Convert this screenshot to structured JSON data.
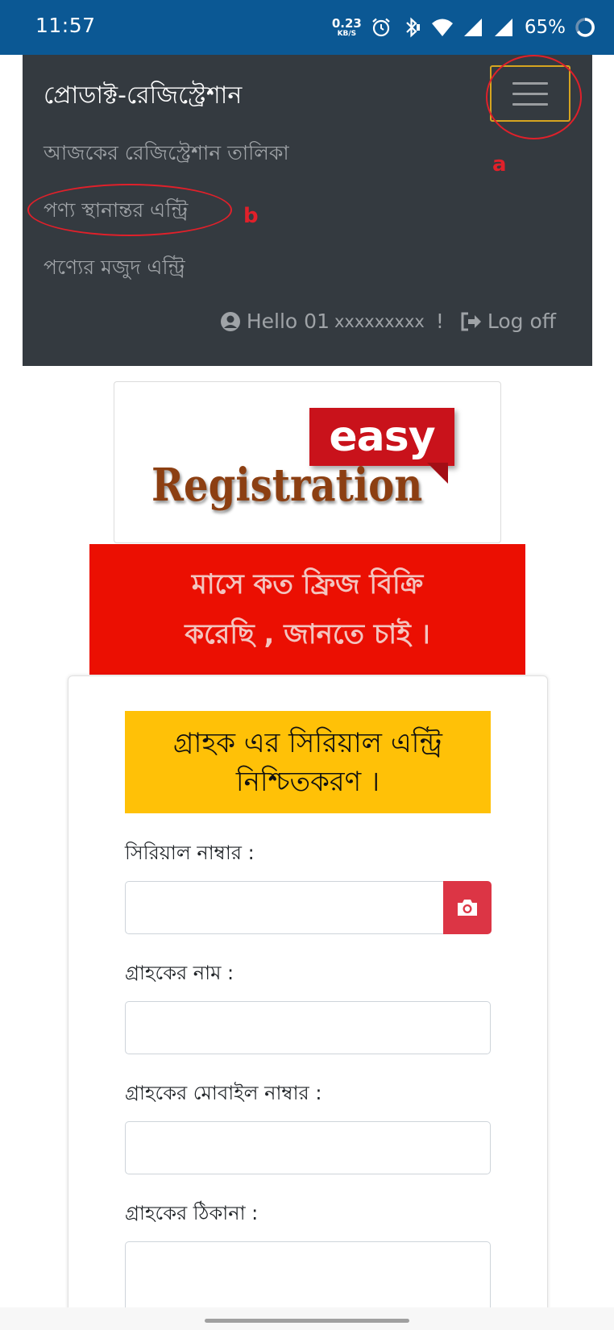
{
  "status_bar": {
    "time": "11:57",
    "net_speed_value": "0.23",
    "net_speed_unit": "KB/S",
    "battery": "65%",
    "icons": [
      "alarm-icon",
      "bluetooth-icon",
      "wifi-icon",
      "signal-icon",
      "signal-icon",
      "battery-icon"
    ]
  },
  "navbar": {
    "brand": "প্রোডাক্ট-রেজিস্ট্রেশান",
    "links": [
      {
        "label": "আজকের রেজিস্ট্রেশান তালিকা"
      },
      {
        "label": "পণ্য স্থানান্তর এন্ট্রি"
      },
      {
        "label": "পণ্যের মজুদ এন্ট্রি"
      }
    ],
    "hello_text": "Hello 01",
    "hello_masked": "xxxxxxxxx",
    "hello_suffix": "!",
    "logoff": "Log off",
    "toggler_icon": "hamburger-menu-icon"
  },
  "annotations": {
    "a": "a",
    "b": "b",
    "color": "#e0202a"
  },
  "logo": {
    "word1": "easy",
    "word2": "Registration"
  },
  "banner": {
    "line1": "মাসে কত ফ্রিজ বিক্রি",
    "line2": "করেছি , জানতে চাই ।",
    "color": "#eb0f02"
  },
  "form": {
    "heading_line1": "গ্রাহক এর সিরিয়াল এন্ট্রি",
    "heading_line2": "নিশ্চিতকরণ ।",
    "heading_color": "#ffc107",
    "fields": [
      {
        "label": "সিরিয়াল নাম্বার :",
        "value": ""
      },
      {
        "label": "গ্রাহকের নাম :",
        "value": ""
      },
      {
        "label": "গ্রাহকের মোবাইল নাম্বার :",
        "value": ""
      },
      {
        "label": "গ্রাহকের ঠিকানা :",
        "value": ""
      }
    ],
    "camera_icon": "camera-icon",
    "camera_color": "#dc3545"
  }
}
